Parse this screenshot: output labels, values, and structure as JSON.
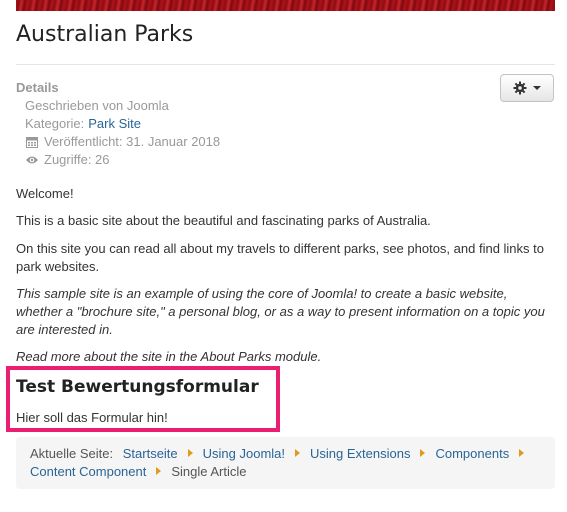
{
  "article": {
    "title": "Australian Parks",
    "details": {
      "heading": "Details",
      "author": "Geschrieben von Joomla",
      "category_label": "Kategorie:",
      "category_link": "Park Site",
      "published": "Veröffentlicht: 31. Januar 2018",
      "hits": "Zugriffe: 26"
    },
    "paragraphs": [
      "Welcome!",
      "This is a basic site about the beautiful and fascinating parks of Australia.",
      "On this site you can read all about my travels to different parks, see photos, and find links to park websites.",
      "This sample site is an example of using the core of Joomla! to create a basic website, whether a \"brochure site,\" a personal blog, or as a way to present information on a topic you are interested in.",
      "Read more about the site in the About Parks module."
    ],
    "test_section": {
      "title": "Test Bewertungsformular",
      "text": "Hier soll das Formular hin!"
    }
  },
  "tools": {
    "icon": "gear-icon",
    "caret": "caret-down-icon"
  },
  "breadcrumb": {
    "label": "Aktuelle Seite:",
    "links": [
      "Startseite",
      "Using Joomla!",
      "Using Extensions",
      "Components",
      "Content Component"
    ],
    "current": "Single Article"
  },
  "colors": {
    "link": "#2a6496",
    "highlight": "#ea1f72",
    "separator": "#e29a1e"
  }
}
